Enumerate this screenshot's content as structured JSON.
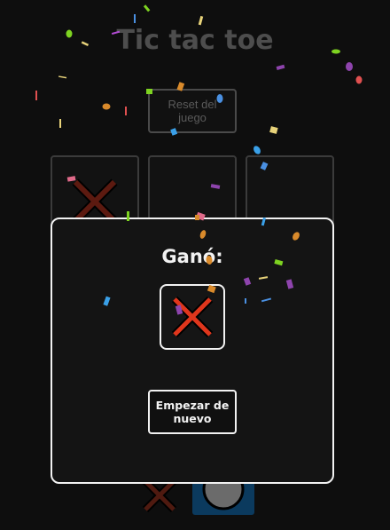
{
  "game": {
    "title": "Tic tac toe",
    "reset_label": "Reset del juego"
  },
  "board": {
    "visible_cells": [
      "X",
      "",
      ""
    ],
    "bottom_row": [
      "X",
      "O"
    ]
  },
  "modal": {
    "winner_label": "Ganó:",
    "winner_mark": "X",
    "restart_label": "Empezar de nuevo"
  },
  "colors": {
    "background": "#0e0e0e",
    "x_mark": "#e0361c",
    "x_outline": "#000000",
    "modal_border": "#f2f2f2",
    "o_cell_bg": "#0b3a5e",
    "o_mark": "#6b6b6b"
  },
  "icons": {
    "x_mark": "x-mark-icon",
    "o_mark": "o-mark-icon",
    "confetti": "confetti-particles"
  }
}
